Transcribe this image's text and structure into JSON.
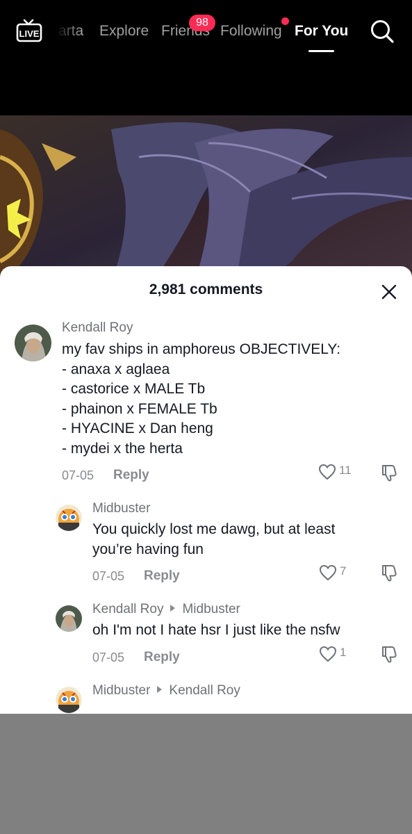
{
  "nav": {
    "tabs": [
      "arta",
      "Explore",
      "Friends",
      "Following",
      "For You"
    ],
    "active_tab": "For You",
    "friends_badge": "98",
    "live_label": "LIVE"
  },
  "sheet": {
    "title": "2,981 comments"
  },
  "comments": [
    {
      "username": "Kendall Roy",
      "text": "my fav ships in amphoreus OBJECTIVELY:\n- anaxa x aglaea\n- castorice x MALE Tb\n- phainon x FEMALE Tb\n- HYACINE x Dan heng\n- mydei x the herta",
      "date": "07-05",
      "reply_label": "Reply",
      "likes": "11"
    },
    {
      "username": "Midbuster",
      "text": "You quickly lost me dawg, but at least\nyou’re having fun",
      "date": "07-05",
      "reply_label": "Reply",
      "likes": "7"
    },
    {
      "username": "Kendall Roy",
      "reply_to": "Midbuster",
      "text": "oh I'm not I hate hsr I just like the nsfw",
      "date": "07-05",
      "reply_label": "Reply",
      "likes": "1"
    },
    {
      "username": "Midbuster",
      "reply_to": "Kendall Roy"
    }
  ],
  "colors": {
    "accent": "#fe2c55",
    "text": "#161823",
    "muted": "#8a8b91"
  }
}
